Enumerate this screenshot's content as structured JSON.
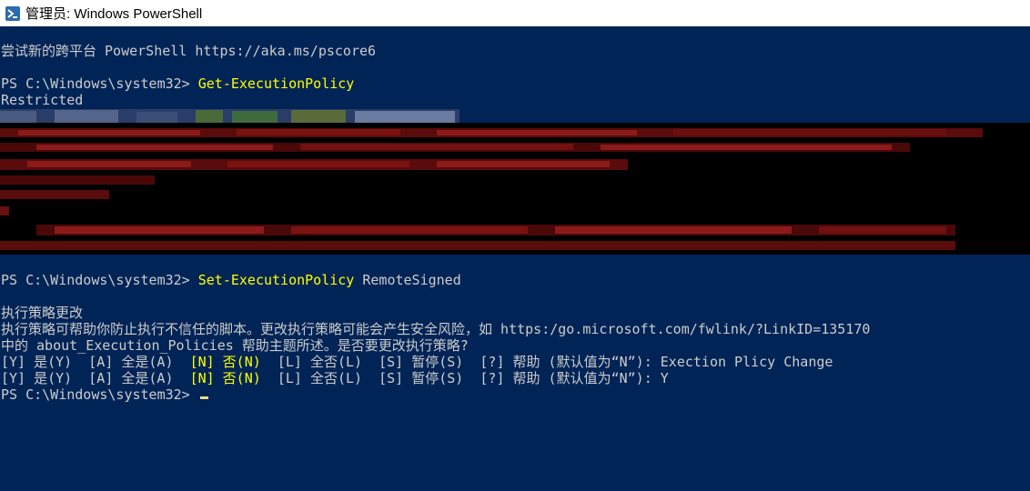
{
  "window": {
    "title": "管理员: Windows PowerShell",
    "icon": "powershell-icon"
  },
  "console": {
    "banner": "尝试新的跨平台 PowerShell https://aka.ms/pscore6",
    "prompt1": "PS C:\\Windows\\system32> ",
    "cmd1": "Get-ExecutionPolicy",
    "out1": "Restricted",
    "prompt2": "PS C:\\Windows\\system32> ",
    "cmd2_name": "Set-ExecutionPolicy",
    "cmd2_arg": " RemoteSigned",
    "heading": "执行策略更改",
    "msg1": "执行策略可帮助你防止执行不信任的脚本。更改执行策略可能会产生安全风险，如 https:/go.microsoft.com/fwlink/?LinkID=135170",
    "msg2": "中的 about_Execution_Policies 帮助主题所述。是否要更改执行策略?",
    "choices_pre": "[Y] 是(Y)  [A] 全是(A)  ",
    "choice_no": "[N] 否(N)",
    "choices_post": "  [L] 全否(L)  [S] 暂停(S)  [?] 帮助 (默认值为“N”): ",
    "answer1": "Exection Plicy Change",
    "answer2": "Y",
    "prompt3": "PS C:\\Windows\\system32> "
  },
  "colors": {
    "background": "#012456",
    "text": "#cccccc",
    "command": "#ffff00",
    "redaction_band": "#000000",
    "redaction_red": "#8b0000"
  }
}
